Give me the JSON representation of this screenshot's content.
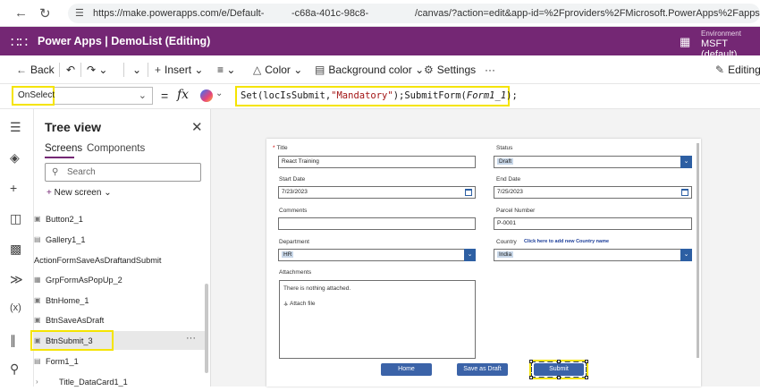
{
  "browser": {
    "url_part1": "https://make.powerapps.com/e/Default-",
    "url_part2": "-c68a-401c-98c8-",
    "url_part3": "/canvas/?action=edit&app-id=%2Fproviders%2FMicrosoft.PowerApps%2Fapps%2F..."
  },
  "header": {
    "app_title": "Power Apps  |  DemoList (Editing)",
    "env_label": "Environment",
    "env_name": "MSFT (default)"
  },
  "toolbar": {
    "back": "Back",
    "insert": "Insert",
    "color": "Color",
    "background_color": "Background color",
    "settings": "Settings",
    "more": "···",
    "editing": "Editing"
  },
  "formula_bar": {
    "property": "OnSelect",
    "fx": "fx",
    "formula_a": "Set(locIsSubmit,",
    "formula_b": "\"Mandatory\"",
    "formula_c": ");SubmitForm(",
    "formula_d": "Form1_1",
    "formula_e": ");"
  },
  "tree_view": {
    "title": "Tree view",
    "tab_screens": "Screens",
    "tab_components": "Components",
    "search_placeholder": "Search",
    "new_screen": "New screen",
    "items": [
      {
        "label": "Button2_1",
        "icon": "button-icon"
      },
      {
        "label": "Gallery1_1",
        "icon": "gallery-icon"
      },
      {
        "label": "ActionFormSaveAsDraftandSubmit",
        "icon": ""
      },
      {
        "label": "GrpFormAsPopUp_2",
        "icon": "group-icon"
      },
      {
        "label": "BtnHome_1",
        "icon": "button-icon"
      },
      {
        "label": "BtnSaveAsDraft",
        "icon": "button-icon"
      },
      {
        "label": "BtnSubmit_3",
        "icon": "button-icon"
      },
      {
        "label": "Form1_1",
        "icon": "form-icon"
      },
      {
        "label": "Title_DataCard1_1",
        "icon": "card-icon"
      }
    ],
    "selected_more": "···"
  },
  "form": {
    "title_label": "Title",
    "title_value": "React Training",
    "status_label": "Status",
    "status_value": "Draft",
    "start_date_label": "Start Date",
    "start_date_value": "7/23/2023",
    "end_date_label": "End Date",
    "end_date_value": "7/25/2023",
    "comments_label": "Comments",
    "comments_value": "",
    "parcel_label": "Parcel Number",
    "parcel_value": "P-0001",
    "department_label": "Department",
    "department_value": "HR",
    "country_label": "Country",
    "country_value": "India",
    "add_country_link": "Click here to add new Country name",
    "attachments_label": "Attachments",
    "attachments_empty": "There is nothing attached.",
    "attach_file": "Attach file",
    "btn_home": "Home",
    "btn_save_draft": "Save as Draft",
    "btn_submit": "Submit"
  },
  "colors": {
    "header": "#742774",
    "highlight": "#f5e400",
    "form_button": "#3b63a8"
  }
}
